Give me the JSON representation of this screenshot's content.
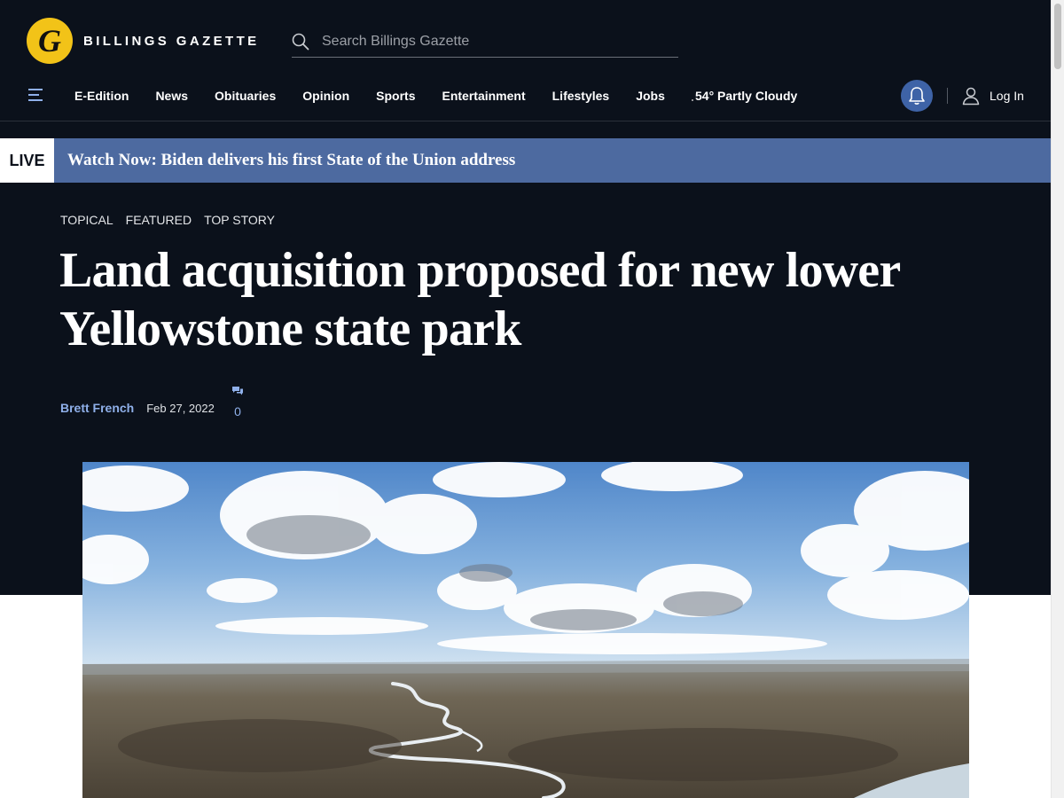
{
  "brand": {
    "logo_letter": "G",
    "name": "BILLINGS GAZETTE"
  },
  "search": {
    "placeholder": "Search Billings Gazette"
  },
  "nav": {
    "items": [
      "E-Edition",
      "News",
      "Obituaries",
      "Opinion",
      "Sports",
      "Entertainment",
      "Lifestyles",
      "Jobs"
    ],
    "weather": "54° Partly Cloudy",
    "login_label": "Log In"
  },
  "live": {
    "badge": "LIVE",
    "text": "Watch Now: Biden delivers his first State of the Union address"
  },
  "article": {
    "tags": [
      "TOPICAL",
      "FEATURED",
      "TOP STORY"
    ],
    "headline": "Land acquisition proposed for new lower Yellowstone state park",
    "author": "Brett French",
    "date": "Feb 27, 2022",
    "comment_count": "0"
  },
  "colors": {
    "page_dark": "#0b111b",
    "accent_blue": "#3e63a7",
    "live_bar": "#4d6aa0",
    "logo_yellow": "#f2c318",
    "link_blue": "#8fb0ea"
  },
  "icons": {
    "search": "search-icon",
    "menu": "hamburger-menu-icon",
    "bell": "bell-icon",
    "user": "user-icon",
    "comment": "comment-icon"
  }
}
